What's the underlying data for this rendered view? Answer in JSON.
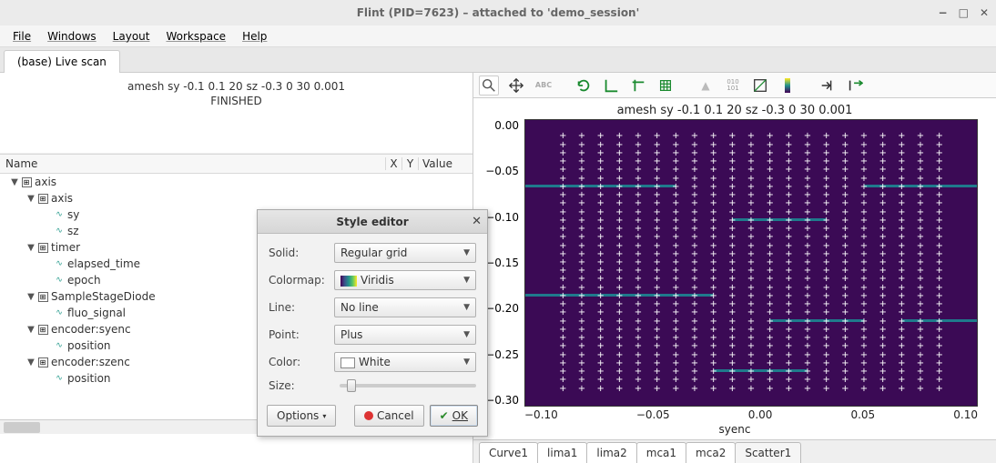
{
  "window": {
    "title": "Flint (PID=7623) – attached to 'demo_session'"
  },
  "menu": {
    "items": [
      "File",
      "Windows",
      "Layout",
      "Workspace",
      "Help"
    ]
  },
  "main_tab": {
    "label": "(base) Live scan"
  },
  "scan": {
    "command": "amesh sy -0.1 0.1 20 sz -0.3 0 30 0.001",
    "status": "FINISHED"
  },
  "tree": {
    "headers": {
      "name": "Name",
      "x": "X",
      "y": "Y",
      "value": "Value"
    },
    "rows": [
      {
        "indent": 0,
        "toggle": "▼",
        "icon": "axis",
        "label": "axis"
      },
      {
        "indent": 1,
        "toggle": "▼",
        "icon": "axis",
        "label": "axis"
      },
      {
        "indent": 2,
        "toggle": "",
        "icon": "sig",
        "label": "sy",
        "radios": [
          false,
          false
        ],
        "check": false
      },
      {
        "indent": 2,
        "toggle": "",
        "icon": "sig",
        "label": "sz",
        "radios": [
          false,
          false
        ],
        "check": false
      },
      {
        "indent": 1,
        "toggle": "▼",
        "icon": "axis",
        "label": "timer"
      },
      {
        "indent": 2,
        "toggle": "",
        "icon": "sig",
        "label": "elapsed_time",
        "radios": [
          false,
          false
        ],
        "check": false
      },
      {
        "indent": 2,
        "toggle": "",
        "icon": "sig",
        "label": "epoch",
        "radios": [
          false,
          false
        ],
        "check": false
      },
      {
        "indent": 1,
        "toggle": "▼",
        "icon": "axis",
        "label": "SampleStageDiode"
      },
      {
        "indent": 2,
        "toggle": "",
        "icon": "sig",
        "label": "fluo_signal",
        "radios": [
          false,
          false
        ],
        "check": true
      },
      {
        "indent": 1,
        "toggle": "▼",
        "icon": "axis",
        "label": "encoder:syenc"
      },
      {
        "indent": 2,
        "toggle": "",
        "icon": "sig",
        "label": "position",
        "radios": [
          true,
          false
        ],
        "check": false
      },
      {
        "indent": 1,
        "toggle": "▼",
        "icon": "axis",
        "label": "encoder:szenc"
      },
      {
        "indent": 2,
        "toggle": "",
        "icon": "sig",
        "label": "position",
        "radios": [
          false,
          true
        ],
        "check": false
      }
    ]
  },
  "style_editor": {
    "title": "Style editor",
    "fields": {
      "solid_label": "Solid:",
      "solid_value": "Regular grid",
      "colormap_label": "Colormap:",
      "colormap_value": "Viridis",
      "line_label": "Line:",
      "line_value": "No line",
      "point_label": "Point:",
      "point_value": "Plus",
      "color_label": "Color:",
      "color_value": "White",
      "size_label": "Size:"
    },
    "buttons": {
      "options": "Options",
      "cancel": "Cancel",
      "ok": "OK"
    }
  },
  "toolbar_icons": [
    "zoom",
    "pan",
    "roi",
    "refresh",
    "axes",
    "crosshair",
    "grid",
    "histogram",
    "bits",
    "contrast",
    "colorbar",
    "export",
    "save"
  ],
  "plot": {
    "title": "amesh sy -0.1 0.1 20 sz -0.3 0 30 0.001",
    "yticks": [
      "0.00",
      "−0.05",
      "−0.10",
      "−0.15",
      "−0.20",
      "−0.25",
      "−0.30"
    ],
    "xticks": [
      "−0.10",
      "−0.05",
      "0.00",
      "0.05",
      "0.10"
    ],
    "xlabel": "syenc"
  },
  "bottom_tabs": [
    "Curve1",
    "lima1",
    "lima2",
    "mca1",
    "mca2",
    "Scatter1"
  ],
  "active_bottom_tab": "Scatter1",
  "colors": {
    "viridis_dark": "#3b0a55",
    "viridis_green": "#b8d43c",
    "accent_green": "#1a8a2f"
  },
  "chart_data": {
    "type": "scatter",
    "title": "amesh sy -0.1 0.1 20 sz -0.3 0 30 0.001",
    "xlabel": "syenc",
    "ylabel": "",
    "xlim": [
      -0.12,
      0.12
    ],
    "ylim": [
      -0.32,
      0.02
    ],
    "x_points": 21,
    "y_points": 31,
    "x_range": [
      -0.1,
      0.1
    ],
    "y_range": [
      -0.3,
      0.0
    ],
    "point_marker": "plus",
    "point_color": "white",
    "colormap": "viridis",
    "high_value_regions_approx": [
      {
        "x": [
          -0.12,
          -0.04
        ],
        "y": [
          -0.06,
          -0.02
        ],
        "note": "top-left block"
      },
      {
        "x": [
          -0.01,
          0.04
        ],
        "y": [
          -0.1,
          -0.04
        ],
        "note": "upper-center block"
      },
      {
        "x": [
          0.06,
          0.12
        ],
        "y": [
          -0.06,
          -0.01
        ],
        "note": "top-right block"
      },
      {
        "x": [
          -0.12,
          -0.02
        ],
        "y": [
          -0.19,
          -0.12
        ],
        "note": "mid-left band"
      },
      {
        "x": [
          0.01,
          0.06
        ],
        "y": [
          -0.22,
          -0.16
        ],
        "note": "center blob"
      },
      {
        "x": [
          0.08,
          0.12
        ],
        "y": [
          -0.22,
          -0.14
        ],
        "note": "right band"
      },
      {
        "x": [
          -0.02,
          0.03
        ],
        "y": [
          -0.28,
          -0.24
        ],
        "note": "lower-center spot"
      }
    ]
  }
}
